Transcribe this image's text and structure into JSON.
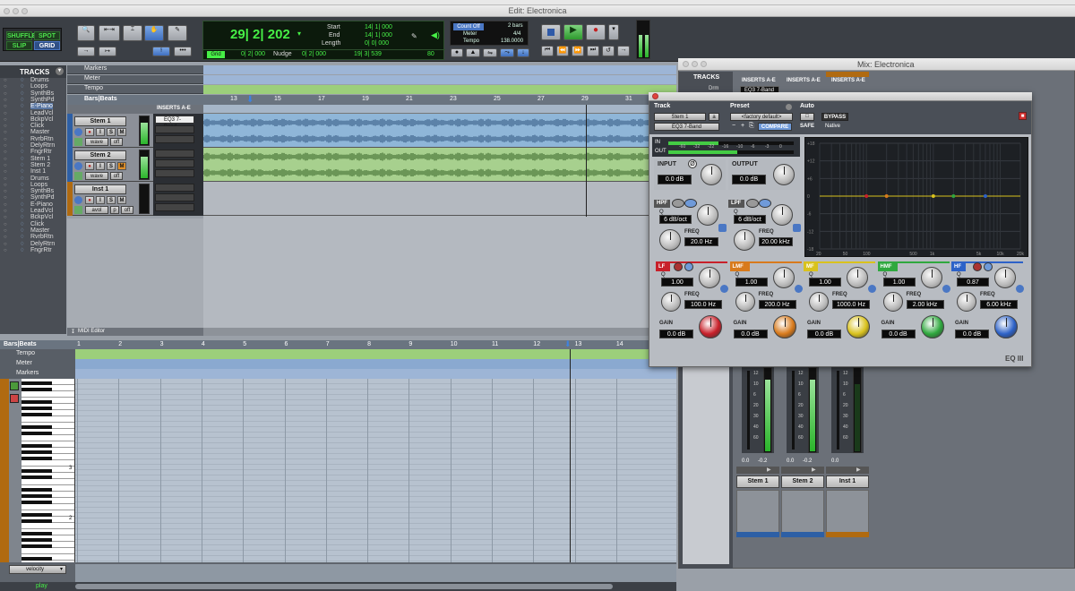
{
  "edit_window": {
    "title": "Edit: Electronica",
    "modes": {
      "shuffle": "SHUFFLE",
      "spot": "SPOT",
      "slip": "SLIP",
      "grid": "GRID"
    },
    "main_counter": "29| 2| 202",
    "selection": {
      "start_label": "Start",
      "end_label": "End",
      "length_label": "Length",
      "start": "14| 1| 000",
      "end": "14| 1| 000",
      "length": "0| 0| 000"
    },
    "grid_label": "Grid",
    "grid_value": "0| 2| 000",
    "nudge_label": "Nudge",
    "nudge_value": "0| 2| 000",
    "cursor_value": "19| 3| 539",
    "cursor_extra": "80",
    "count_off": "Count Off",
    "count_off_value": "2 bars",
    "meter_label": "Meter",
    "meter_value": "4/4",
    "tempo_label": "Tempo",
    "tempo_value": "138.0000"
  },
  "tracks_panel": {
    "header": "TRACKS",
    "items": [
      "Drums",
      "Loops",
      "SynthBs",
      "SynthPd",
      "E-Piano",
      "LeadVcl",
      "BckpVcl",
      "Click",
      "Master",
      "RvrbRtn",
      "DelyRtrn",
      "FngrRtr",
      "Stem 1",
      "Stem 2",
      "Inst 1",
      "Drums",
      "Loops",
      "SynthBs",
      "SynthPd",
      "E-Piano",
      "LeadVcl",
      "BckpVcl",
      "Click",
      "Master",
      "RvrbRtn",
      "DelyRtrn",
      "FngrRtr"
    ],
    "selected_index": 4
  },
  "rulers": {
    "markers": "Markers",
    "meter": "Meter",
    "tempo": "Tempo",
    "bars_beats": "Bars|Beats",
    "bar_numbers": [
      "13",
      "15",
      "17",
      "19",
      "21",
      "23",
      "25",
      "27",
      "29",
      "31"
    ]
  },
  "edit_tracks": [
    {
      "name": "Stem 1",
      "mode": "wave",
      "view": "off"
    },
    {
      "name": "Stem 2",
      "mode": "wave",
      "view": "off"
    },
    {
      "name": "Inst 1",
      "mode": "avol",
      "view": "off",
      "extra": "p"
    }
  ],
  "inserts_label": "INSERTS A-E",
  "insert_slot": "EQ3 7-Band",
  "midi_editor_label": "MIDI Editor",
  "midi": {
    "bars_beats": "Bars|Beats",
    "tempo": "Tempo",
    "meter": "Meter",
    "markers": "Markers",
    "bar_numbers": [
      "1",
      "2",
      "3",
      "4",
      "5",
      "6",
      "7",
      "8",
      "9",
      "10",
      "11",
      "12",
      "13",
      "14"
    ],
    "octave_labels": [
      "3",
      "2"
    ],
    "velocity": "velocity",
    "play": "play"
  },
  "mix_window": {
    "title": "Mix: Electronica",
    "tracks_header": "TRACKS",
    "track_item": "Drm",
    "inserts_label": "INSERTS A-E",
    "insert_slot": "EQ3 7-Band",
    "channels": [
      {
        "name": "Stem 1",
        "vol": "0.0",
        "pan": "-0.2"
      },
      {
        "name": "Stem 2",
        "vol": "0.0",
        "pan": "-0.2"
      },
      {
        "name": "Inst 1",
        "vol": "0.0",
        "pan": ""
      }
    ],
    "meter_scale": [
      "12",
      "10",
      "6",
      "20",
      "30",
      "40",
      "60"
    ]
  },
  "plugin": {
    "track_label": "Track",
    "preset_label": "Preset",
    "auto_label": "Auto",
    "track_value": "Stem 1",
    "track_suffix": "a",
    "preset_value": "<factory default>",
    "plugin_name": "EQ3 7-Band",
    "compare": "COMPARE",
    "bypass": "BYPASS",
    "safe": "SAFE",
    "native": "Native",
    "in_label": "IN",
    "out_label": "OUT",
    "meter_scale": [
      "-60",
      "-32",
      "-22",
      "-16",
      "-10",
      "-6",
      "-3",
      "0"
    ],
    "input": {
      "label": "INPUT",
      "value": "0.0 dB"
    },
    "output": {
      "label": "OUTPUT",
      "value": "0.0 dB"
    },
    "hpf": {
      "label": "HPF",
      "q_label": "Q",
      "q_value": "6 dB/oct",
      "freq_label": "FREQ",
      "freq_value": "20.0 Hz"
    },
    "lpf": {
      "label": "LPF",
      "q_label": "Q",
      "q_value": "6 dB/oct",
      "freq_label": "FREQ",
      "freq_value": "20.00 kHz"
    },
    "bands": [
      {
        "label": "LF",
        "q": "1.00",
        "freq": "100.0 Hz",
        "gain": "0.0 dB",
        "color": "#c8202a"
      },
      {
        "label": "LMF",
        "q": "1.00",
        "freq": "200.0 Hz",
        "gain": "0.0 dB",
        "color": "#d87a1c"
      },
      {
        "label": "MF",
        "q": "1.00",
        "freq": "1000.0 Hz",
        "gain": "0.0 dB",
        "color": "#d9c21d"
      },
      {
        "label": "HMF",
        "q": "1.00",
        "freq": "2.00 kHz",
        "gain": "0.0 dB",
        "color": "#2fa83e"
      },
      {
        "label": "HF",
        "q": "0.87",
        "freq": "6.00 kHz",
        "gain": "0.0 dB",
        "color": "#2d62c8"
      }
    ],
    "q_label": "Q",
    "freq_label": "FREQ",
    "gain_label": "GAIN",
    "graph_y_labels": [
      "+18",
      "+12",
      "+6",
      "0",
      "-6",
      "-12",
      "-18"
    ],
    "graph_x_labels": [
      "20",
      "50",
      "100",
      "500",
      "1k",
      "5k",
      "10k",
      "20k"
    ],
    "logo": "EQ III"
  }
}
